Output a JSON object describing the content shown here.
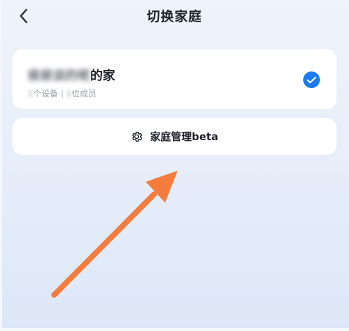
{
  "header": {
    "back_icon": "chevron-left-icon",
    "title": "切换家庭"
  },
  "family": {
    "name_blurred": "侯侯谈的呢",
    "name_suffix": "的家",
    "device_count": "1",
    "device_label": "个设备",
    "separator": " | ",
    "member_count": "1",
    "member_label": "位成员",
    "selected": true,
    "check_icon": "check-circle-icon",
    "accent_color": "#1a7af0"
  },
  "manage": {
    "icon": "gear-icon",
    "label": "家庭管理beta"
  },
  "overlay": {
    "arrow_color": "#f47c3c"
  }
}
